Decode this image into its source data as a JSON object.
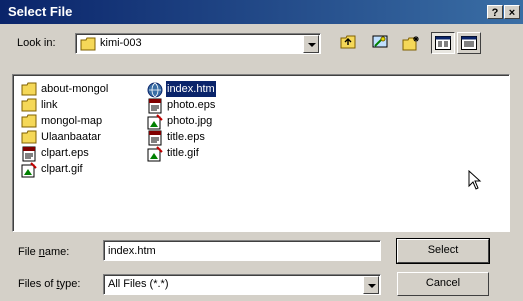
{
  "window": {
    "title": "Select File",
    "help_label": "?",
    "close_label": "×"
  },
  "lookin": {
    "label": "Look in:",
    "value": "kimi-003"
  },
  "toolbar": {
    "icons": [
      "up-folder-icon",
      "desktop-icon",
      "new-folder-icon",
      "list-view-icon",
      "details-view-icon"
    ]
  },
  "files": {
    "col1": [
      {
        "name": "about-mongol",
        "icon": "folder-icon"
      },
      {
        "name": "link",
        "icon": "folder-icon"
      },
      {
        "name": "mongol-map",
        "icon": "folder-icon"
      },
      {
        "name": "Ulaanbaatar",
        "icon": "folder-icon"
      },
      {
        "name": "clpart.eps",
        "icon": "eps-file-icon"
      },
      {
        "name": "clpart.gif",
        "icon": "gif-file-icon"
      }
    ],
    "col2": [
      {
        "name": "index.htm",
        "icon": "html-file-icon",
        "selected": true
      },
      {
        "name": "photo.eps",
        "icon": "eps-file-icon"
      },
      {
        "name": "photo.jpg",
        "icon": "gif-file-icon"
      },
      {
        "name": "title.eps",
        "icon": "eps-file-icon"
      },
      {
        "name": "title.gif",
        "icon": "gif-file-icon"
      }
    ]
  },
  "filename": {
    "label_pre": "File ",
    "label_key": "n",
    "label_post": "ame:",
    "value": "index.htm"
  },
  "filetype": {
    "label_pre": "Files of ",
    "label_key": "t",
    "label_post": "ype:",
    "value": "All Files (*.*)"
  },
  "buttons": {
    "select": "Select",
    "cancel": "Cancel"
  },
  "colors": {
    "titlebar": "#0a246a",
    "face": "#d4d0c8",
    "selection": "#0a246a"
  }
}
